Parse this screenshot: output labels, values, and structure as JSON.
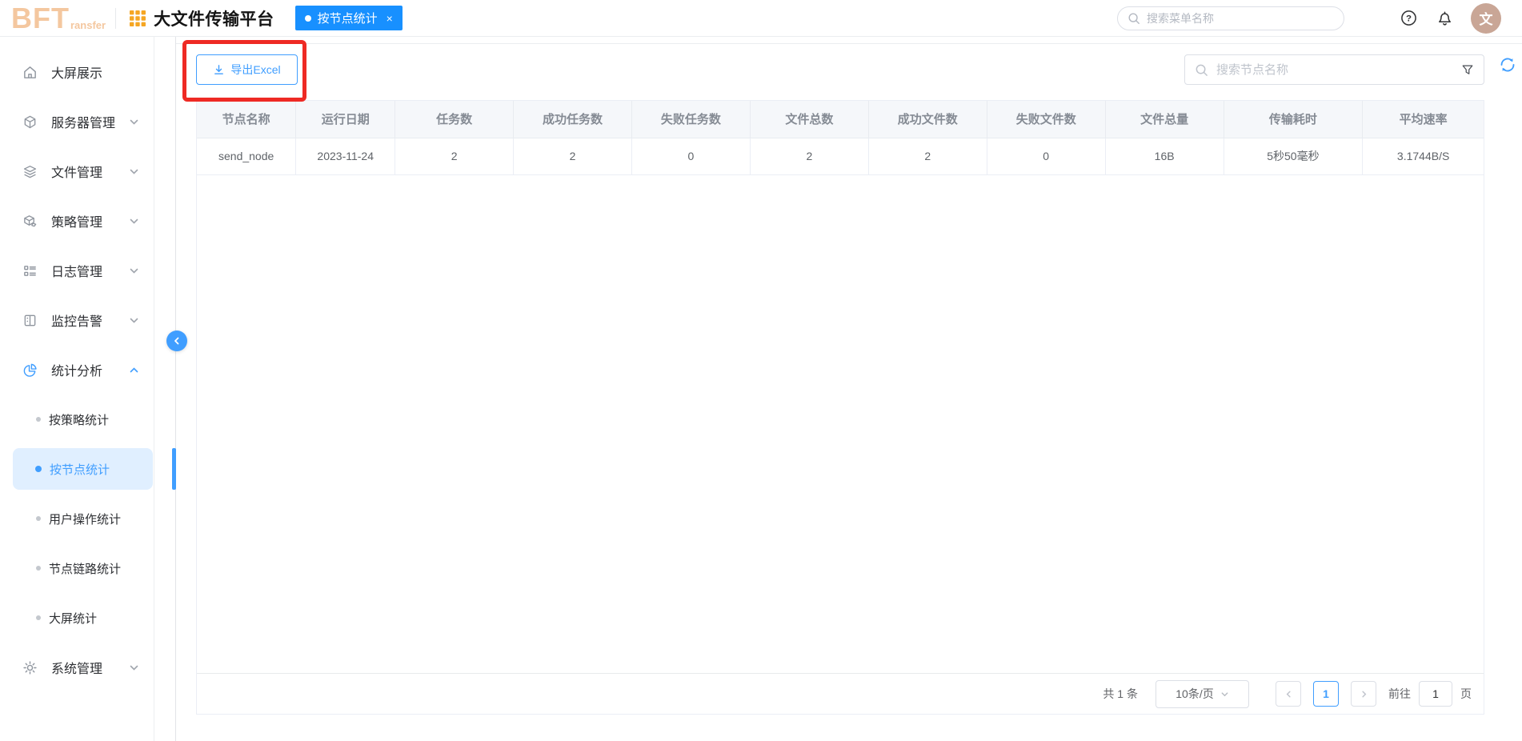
{
  "header": {
    "logo_main": "BFT",
    "logo_sub": "ransfer",
    "app_title": "大文件传输平台",
    "tab_label": "按节点统计",
    "tab_close": "×",
    "menu_search_placeholder": "搜索菜单名称",
    "avatar_text": "文"
  },
  "sidebar": {
    "items": [
      {
        "label": "大屏展示",
        "icon": "home-icon"
      },
      {
        "label": "服务器管理",
        "icon": "server-icon"
      },
      {
        "label": "文件管理",
        "icon": "files-icon"
      },
      {
        "label": "策略管理",
        "icon": "policy-icon"
      },
      {
        "label": "日志管理",
        "icon": "log-icon"
      },
      {
        "label": "监控告警",
        "icon": "monitor-icon"
      },
      {
        "label": "统计分析",
        "icon": "pie-chart-icon",
        "expanded": true,
        "active": true
      },
      {
        "label": "系统管理",
        "icon": "gear-icon"
      }
    ],
    "sub_items": [
      {
        "label": "按策略统计"
      },
      {
        "label": "按节点统计",
        "active": true
      },
      {
        "label": "用户操作统计"
      },
      {
        "label": "节点链路统计"
      },
      {
        "label": "大屏统计"
      }
    ]
  },
  "toolbar": {
    "export_label": "导出Excel",
    "search_placeholder": "搜索节点名称"
  },
  "table": {
    "columns": [
      "节点名称",
      "运行日期",
      "任务数",
      "成功任务数",
      "失败任务数",
      "文件总数",
      "成功文件数",
      "失败文件数",
      "文件总量",
      "传输耗时",
      "平均速率"
    ],
    "rows": [
      [
        "send_node",
        "2023-11-24",
        "2",
        "2",
        "0",
        "2",
        "2",
        "0",
        "16B",
        "5秒50毫秒",
        "3.1744B/S"
      ]
    ]
  },
  "pagination": {
    "total": "共 1 条",
    "page_size": "10条/页",
    "current_page": "1",
    "goto_label": "前往",
    "goto_value": "1",
    "unit_label": "页"
  },
  "colors": {
    "primary_blue": "#409eff",
    "tab_blue": "#1890ff",
    "logo_orange": "#f4c79f",
    "grid_orange": "#f5a623",
    "annotation_red": "#ee2a24",
    "avatar_brown": "#c9a696",
    "table_header_bg": "#f5f7fa"
  }
}
